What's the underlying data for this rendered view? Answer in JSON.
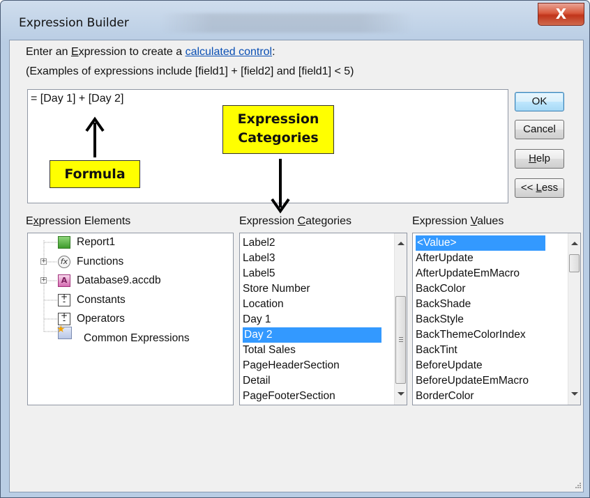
{
  "window": {
    "title": "Expression Builder",
    "close_glyph": "X"
  },
  "instructions": {
    "line1_prefix": "Enter an ",
    "line1_e": "E",
    "line1_mid": "xpression to create a ",
    "line1_link": "calculated control",
    "line1_suffix": ":",
    "line2": "(Examples of expressions include [field1] + [field2] and [field1] < 5)"
  },
  "expression": {
    "value": "= [Day 1] + [Day 2]"
  },
  "buttons": {
    "ok": "OK",
    "cancel": "Cancel",
    "help_key": "H",
    "help_rest": "elp",
    "less_prefix": "<< ",
    "less_key": "L",
    "less_rest": "ess"
  },
  "callouts": {
    "formula": "Formula",
    "categories_line1": "Expression",
    "categories_line2": "Categories",
    "color": "#ffff00"
  },
  "panels": {
    "elements_label_pre": "E",
    "elements_label_key": "x",
    "elements_label_post": "pression Elements",
    "categories_label_pre": "Expression ",
    "categories_label_key": "C",
    "categories_label_post": "ategories",
    "values_label_pre": "Expression ",
    "values_label_key": "V",
    "values_label_post": "alues"
  },
  "elements": [
    {
      "label": "Report1",
      "icon": "report-icon"
    },
    {
      "label": "Functions",
      "icon": "function-icon"
    },
    {
      "label": "Database9.accdb",
      "icon": "database-icon"
    },
    {
      "label": "Constants",
      "icon": "constants-icon"
    },
    {
      "label": "Operators",
      "icon": "operators-icon"
    },
    {
      "label": "Common Expressions",
      "icon": "common-expressions-icon"
    }
  ],
  "categories": [
    "Label2",
    "Label3",
    "Label5",
    "Store Number",
    "Location",
    "Day 1",
    "Day 2",
    "Total Sales",
    "PageHeaderSection",
    "Detail",
    "PageFooterSection"
  ],
  "categories_selected": "Day 2",
  "values": [
    "<Value>",
    "AfterUpdate",
    "AfterUpdateEmMacro",
    "BackColor",
    "BackShade",
    "BackStyle",
    "BackThemeColorIndex",
    "BackTint",
    "BeforeUpdate",
    "BeforeUpdateEmMacro",
    "BorderColor"
  ],
  "values_selected": "<Value>",
  "colors": {
    "selection": "#3399ff",
    "link": "#0a4fb4"
  }
}
